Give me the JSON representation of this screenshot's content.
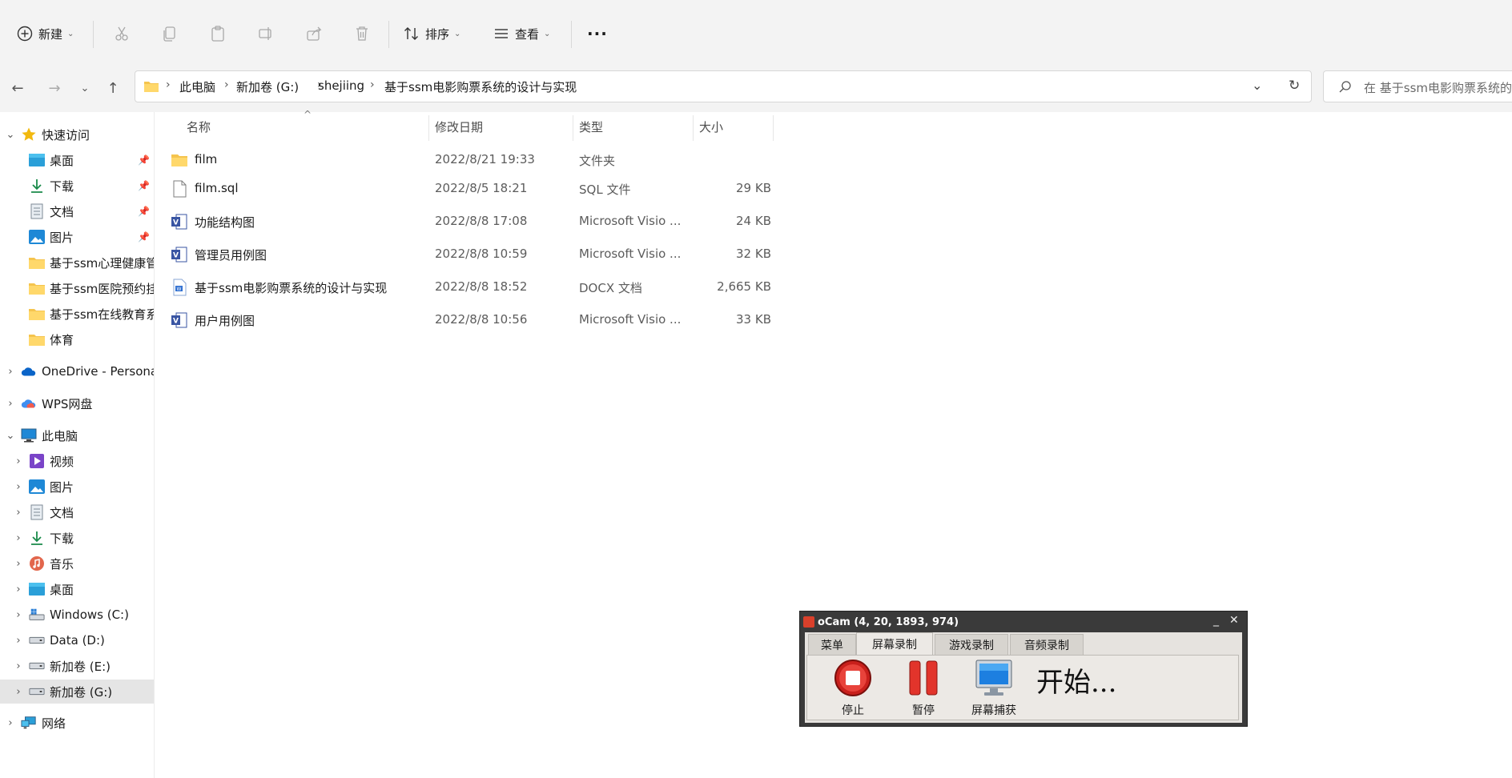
{
  "toolbar": {
    "new_label": "新建",
    "sort_label": "排序",
    "view_label": "查看",
    "more_label": "···"
  },
  "address": {
    "crumbs": [
      "此电脑",
      "新加卷 (G:)",
      "shejiing",
      "基于ssm电影购票系统的设计与实现"
    ],
    "search_placeholder": "在 基于ssm电影购票系统的..."
  },
  "sidebar": {
    "quick_access": "快速访问",
    "quick_items": [
      "桌面",
      "下载",
      "文档",
      "图片",
      "基于ssm心理健康管",
      "基于ssm医院预约挂",
      "基于ssm在线教育系",
      "体育"
    ],
    "onedrive": "OneDrive - Persona",
    "wps": "WPS网盘",
    "this_pc": "此电脑",
    "pc_items": [
      "视频",
      "图片",
      "文档",
      "下载",
      "音乐",
      "桌面",
      "Windows (C:)",
      "Data (D:)",
      "新加卷 (E:)",
      "新加卷 (G:)"
    ],
    "network": "网络"
  },
  "columns": {
    "name": "名称",
    "date": "修改日期",
    "type": "类型",
    "size": "大小"
  },
  "files": [
    {
      "name": "film",
      "date": "2022/8/21 19:33",
      "type": "文件夹",
      "size": "",
      "icon": "folder-icon"
    },
    {
      "name": "film.sql",
      "date": "2022/8/5 18:21",
      "type": "SQL 文件",
      "size": "29 KB",
      "icon": "file-icon"
    },
    {
      "name": "功能结构图",
      "date": "2022/8/8 17:08",
      "type": "Microsoft Visio ...",
      "size": "24 KB",
      "icon": "visio-icon"
    },
    {
      "name": "管理员用例图",
      "date": "2022/8/8 10:59",
      "type": "Microsoft Visio ...",
      "size": "32 KB",
      "icon": "visio-icon"
    },
    {
      "name": "基于ssm电影购票系统的设计与实现",
      "date": "2022/8/8 18:52",
      "type": "DOCX 文档",
      "size": "2,665 KB",
      "icon": "docx-icon"
    },
    {
      "name": "用户用例图",
      "date": "2022/8/8 10:56",
      "type": "Microsoft Visio ...",
      "size": "33 KB",
      "icon": "visio-icon"
    }
  ],
  "ocam": {
    "title": "oCam (4, 20, 1893, 974)",
    "tabs": [
      "菜单",
      "屏幕录制",
      "游戏录制",
      "音频录制"
    ],
    "stop_label": "停止",
    "pause_label": "暂停",
    "capture_label": "屏幕捕获",
    "status": "开始...",
    "minimize": "_",
    "close": "✕"
  }
}
